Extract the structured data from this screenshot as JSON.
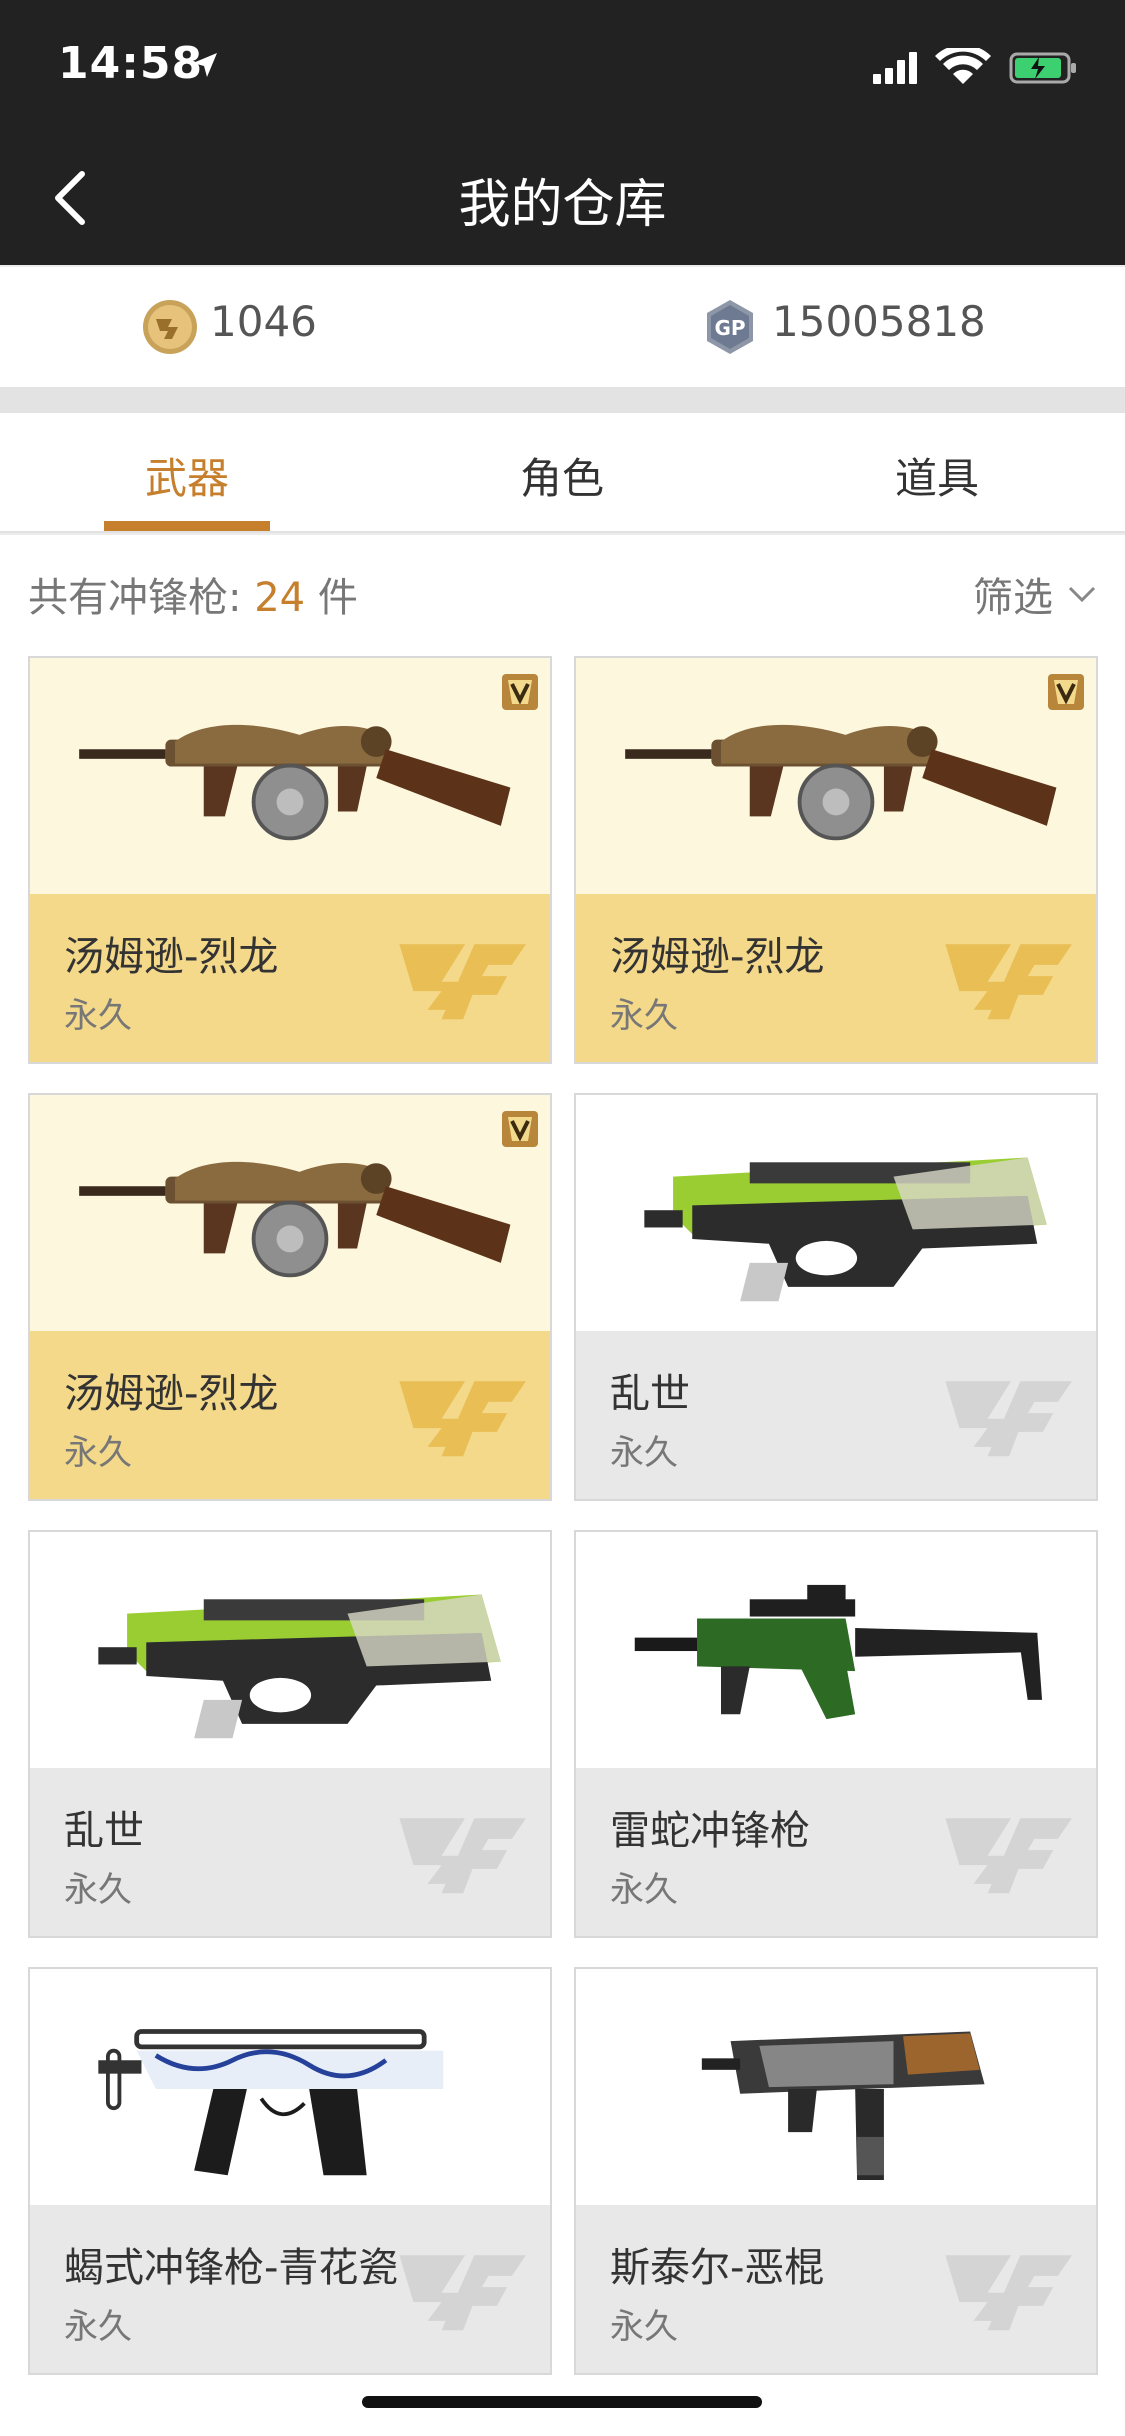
{
  "status_bar": {
    "time": "14:58"
  },
  "nav": {
    "title": "我的仓库"
  },
  "currency": [
    {
      "icon": "cf-coin-icon",
      "value": "1046"
    },
    {
      "icon": "gp-coin-icon",
      "value": "15005818"
    }
  ],
  "tabs": [
    {
      "label": "武器",
      "active": true
    },
    {
      "label": "角色",
      "active": false
    },
    {
      "label": "道具",
      "active": false
    }
  ],
  "summary": {
    "prefix": "共有冲锋枪: ",
    "count": "24",
    "suffix": " 件",
    "filter_label": "筛选"
  },
  "items": [
    {
      "name": "汤姆逊-烈龙",
      "duration": "永久",
      "style": "gold",
      "vip": true,
      "gun": "thompson"
    },
    {
      "name": "汤姆逊-烈龙",
      "duration": "永久",
      "style": "gold",
      "vip": true,
      "gun": "thompson"
    },
    {
      "name": "汤姆逊-烈龙",
      "duration": "永久",
      "style": "gold",
      "vip": true,
      "gun": "thompson"
    },
    {
      "name": "乱世",
      "duration": "永久",
      "style": "grey",
      "vip": false,
      "gun": "p90"
    },
    {
      "name": "乱世",
      "duration": "永久",
      "style": "grey",
      "vip": false,
      "gun": "p90"
    },
    {
      "name": "雷蛇冲锋枪",
      "duration": "永久",
      "style": "grey",
      "vip": false,
      "gun": "vector"
    },
    {
      "name": "蝎式冲锋枪-青花瓷",
      "duration": "永久",
      "style": "grey",
      "vip": false,
      "gun": "scorpion"
    },
    {
      "name": "斯泰尔-恶棍",
      "duration": "永久",
      "style": "grey",
      "vip": false,
      "gun": "tmp"
    }
  ],
  "colors": {
    "accent": "#c67f2c",
    "gold_info": "#f4d98a",
    "gold_img": "#fdf7dd",
    "grey_info": "#e8e8e8",
    "header": "#222222"
  }
}
